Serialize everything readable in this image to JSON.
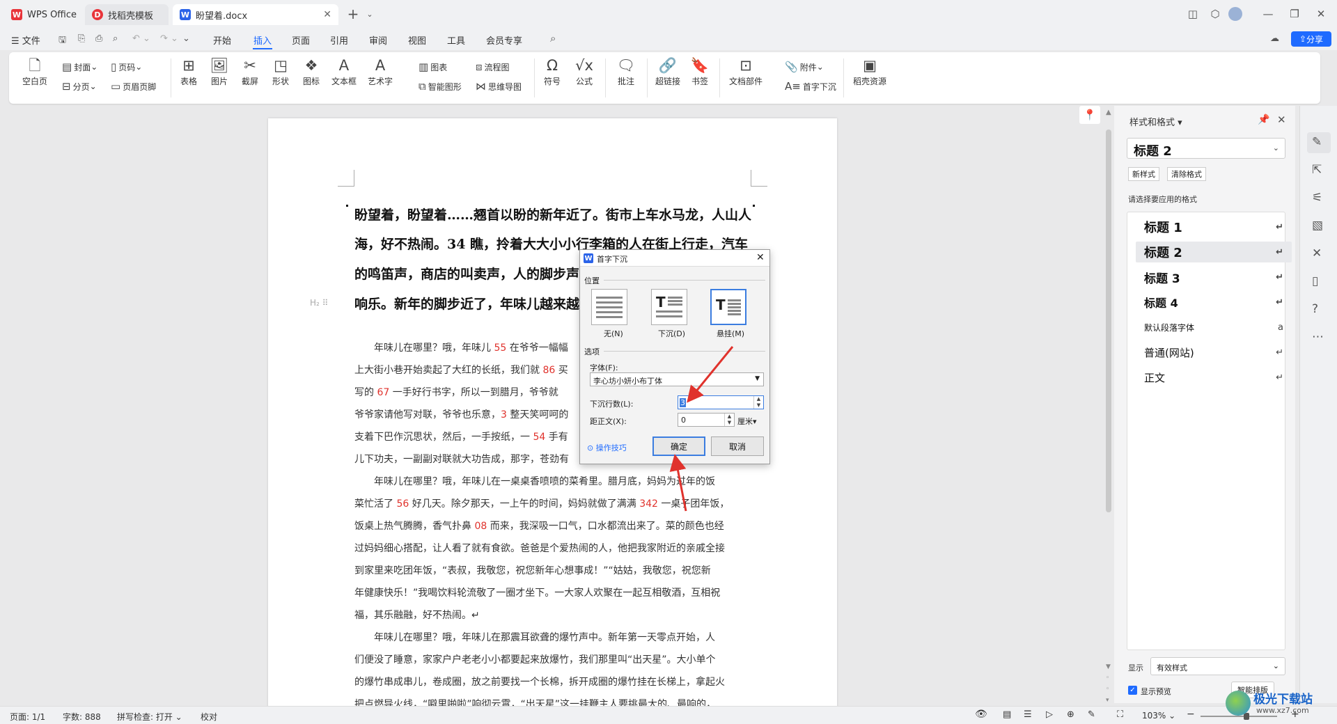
{
  "tabs": [
    {
      "label": "WPS Office"
    },
    {
      "label": "找稻壳模板"
    },
    {
      "label": "盼望着.docx"
    }
  ],
  "menu": {
    "file": "文件",
    "items": [
      "开始",
      "插入",
      "页面",
      "引用",
      "审阅",
      "视图",
      "工具",
      "会员专享"
    ],
    "active": "插入",
    "share": "分享"
  },
  "ribbon": {
    "blank_page": "空白页",
    "cover": "封面",
    "page_break": "分页",
    "page_number": "页码",
    "header_footer": "页眉页脚",
    "table": "表格",
    "picture": "图片",
    "screenshot": "截屏",
    "shape": "形状",
    "icon": "图标",
    "textbox": "文本框",
    "wordart": "艺术字",
    "chart": "图表",
    "smart_graphic": "智能图形",
    "flowchart": "流程图",
    "mindmap": "思维导图",
    "symbol": "符号",
    "formula": "公式",
    "comment": "批注",
    "hyperlink": "超链接",
    "bookmark": "书签",
    "doc_parts": "文档部件",
    "attachment": "附件",
    "drop_cap": "首字下沉",
    "daoke_resources": "稻壳资源"
  },
  "document": {
    "heading_lines": [
      "盼望着，盼望着……翘首以盼的新年近了。街市上车水马龙，人山人",
      "海，好不热闹。34 瞧，拎着大大小小行李箱的人在街上行走，汽车",
      "的鸣笛声，商店的叫卖声，人的脚步声",
      "响乐。新年的脚步近了，年味儿越来越"
    ],
    "heading_marker": "H₂",
    "body_lines": [
      [
        {
          "t": "　　年味儿在哪里？哦，年味儿 "
        },
        {
          "t": "55",
          "r": 1
        },
        {
          "t": " 在爷爷一幅幅"
        }
      ],
      [
        {
          "t": "上大街小巷开始卖起了大红的长纸，我们就 "
        },
        {
          "t": "86",
          "r": 1
        },
        {
          "t": " 买"
        }
      ],
      [
        {
          "t": "写的 "
        },
        {
          "t": "67",
          "r": 1
        },
        {
          "t": " 一手好行书字，所以一到腊月，爷爷就"
        }
      ],
      [
        {
          "t": "爷爷家请他写对联，爷爷也乐意，"
        },
        {
          "t": "3",
          "r": 1
        },
        {
          "t": " 整天笑呵呵的"
        }
      ],
      [
        {
          "t": "支着下巴作沉思状，然后，一手按纸，一 "
        },
        {
          "t": "54",
          "r": 1
        },
        {
          "t": " 手有"
        }
      ],
      [
        {
          "t": "儿下功夫，一副副对联就大功告成，那字，苍劲有"
        }
      ],
      [
        {
          "t": "　　年味儿在哪里？哦，年味儿在一桌桌香喷喷的菜肴里。腊月底，妈妈为过年的饭"
        }
      ],
      [
        {
          "t": "菜忙活了 "
        },
        {
          "t": "56",
          "r": 1
        },
        {
          "t": " 好几天。除夕那天，一上午的时间，妈妈就做了满满 "
        },
        {
          "t": "342",
          "r": 1
        },
        {
          "t": " 一桌子团年饭，"
        }
      ],
      [
        {
          "t": "饭桌上热气腾腾，香气扑鼻 "
        },
        {
          "t": "08",
          "r": 1
        },
        {
          "t": " 而来，我深吸一口气，口水都流出来了。菜的颜色也经"
        }
      ],
      [
        {
          "t": "过妈妈细心搭配，让人看了就有食欲。爸爸是个爱热闹的人，他把我家附近的亲戚全接"
        }
      ],
      [
        {
          "t": "到家里来吃团年饭，“表叔，我敬您，祝您新年心想事成！”“姑姑，我敬您，祝您新"
        }
      ],
      [
        {
          "t": "年健康快乐！”我喝饮料轮流敬了一圈才坐下。一大家人欢聚在一起互相敬酒，互相祝"
        }
      ],
      [
        {
          "t": "福，其乐融融，好不热闹。↵"
        }
      ],
      [
        {
          "t": "　　年味儿在哪里？哦，年味儿在那震耳欲聋的爆竹声中。新年第一天零点开始，人"
        }
      ],
      [
        {
          "t": "们便没了睡意，家家户户老老小小都要起来放爆竹，我们那里叫“出天星”。大小单个"
        }
      ],
      [
        {
          "t": "的爆竹串成串儿，卷成圈，放之前要找一个长棉，拆开成圈的爆竹挂在长梯上，拿起火"
        }
      ],
      [
        {
          "t": "把点燃导火线，“噼里啪啦”响彻云霄，“出天星”这一挂鞭主人要挑最大的、最响的，"
        }
      ]
    ]
  },
  "dialog": {
    "title": "首字下沉",
    "position_label": "位置",
    "opt_none": "无(N)",
    "opt_drop": "下沉(D)",
    "opt_hang": "悬挂(M)",
    "options_label": "选项",
    "font_label": "字体(F):",
    "font_value": "李心坊小妍小布丁体",
    "lines_label": "下沉行数(L):",
    "lines_value": "3",
    "distance_label": "距正文(X):",
    "distance_value": "0",
    "unit": "厘米",
    "tips": "操作技巧",
    "ok": "确定",
    "cancel": "取消"
  },
  "styles_panel": {
    "title": "样式和格式",
    "current_style": "标题 2",
    "new_style": "新样式",
    "clear_format": "清除格式",
    "choose_label": "请选择要应用的格式",
    "styles": [
      {
        "name": "标题 1",
        "kind": "h"
      },
      {
        "name": "标题 2",
        "kind": "h",
        "selected": true
      },
      {
        "name": "标题 3",
        "kind": "h"
      },
      {
        "name": "标题 4",
        "kind": "h"
      },
      {
        "name": "默认段落字体",
        "kind": "s"
      },
      {
        "name": "普通(网站)",
        "kind": "n"
      },
      {
        "name": "正文",
        "kind": "n"
      }
    ],
    "show_label": "显示",
    "show_value": "有效样式",
    "preview_label": "显示预览",
    "smart_layout": "智能排版"
  },
  "status": {
    "page": "页面: 1/1",
    "words": "字数: 888",
    "spell": "拼写检查: 打开",
    "proof": "校对",
    "zoom": "103%"
  },
  "watermark": {
    "text": "极光下载站",
    "url": "www.xz7.com"
  },
  "colors": {
    "accent": "#1f6bff",
    "red": "#e0322c",
    "arrow": "#e0322c"
  }
}
